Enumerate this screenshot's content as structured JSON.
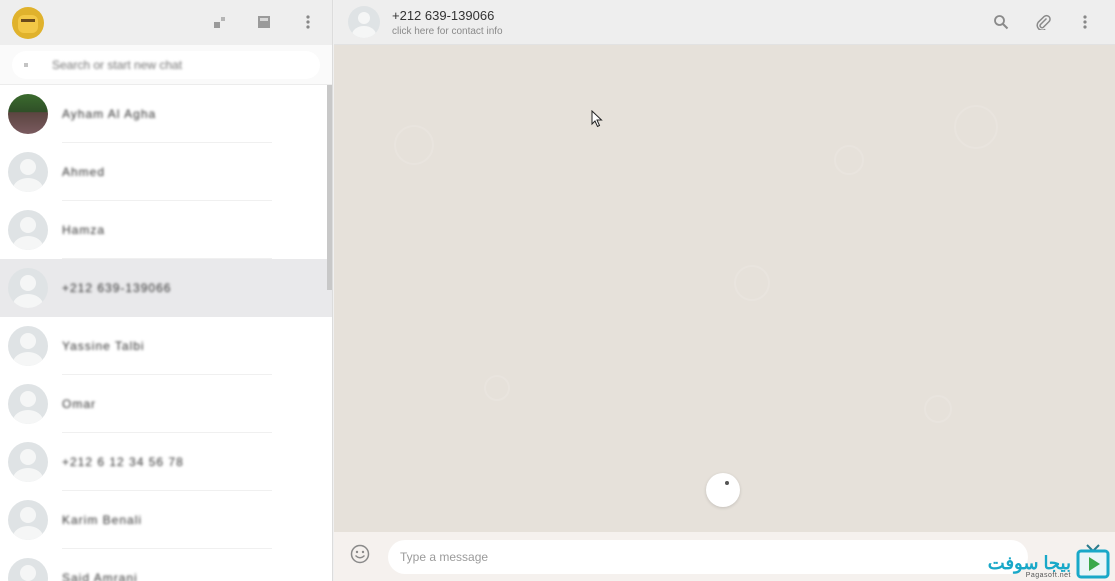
{
  "sidebar": {
    "search": {
      "placeholder": "Search or start new chat"
    },
    "chats": [
      {
        "name": "Ayham Al Agha",
        "avatar": "photo",
        "active": false
      },
      {
        "name": "Ahmed",
        "avatar": "default",
        "active": false
      },
      {
        "name": "Hamza",
        "avatar": "default",
        "active": false
      },
      {
        "name": "+212 639-139066",
        "avatar": "default",
        "active": true
      },
      {
        "name": "Yassine Talbi",
        "avatar": "default",
        "active": false
      },
      {
        "name": "Omar",
        "avatar": "default",
        "active": false
      },
      {
        "name": "+212 6 12 34 56 78",
        "avatar": "default",
        "active": false
      },
      {
        "name": "Karim Benali",
        "avatar": "default",
        "active": false
      },
      {
        "name": "Said Amrani",
        "avatar": "default",
        "active": false
      }
    ],
    "icons": [
      "status-icon",
      "new-chat-icon",
      "menu-icon"
    ]
  },
  "header": {
    "contact_name": "+212 639-139066",
    "contact_subtitle": "click here for contact info",
    "icons": [
      "search-icon",
      "attach-icon",
      "menu-icon"
    ]
  },
  "footer": {
    "message_placeholder": "Type a message",
    "emoji_icon": "emoji-icon"
  },
  "watermark": {
    "brand": "بيجا سوفت",
    "site": "Pagasoft.net"
  },
  "colors": {
    "header_bg": "#eeeeee",
    "conversation_bg": "#e6e1da",
    "active_chat_bg": "#e9e9eb",
    "watermark_accent": "#18a8c8"
  }
}
